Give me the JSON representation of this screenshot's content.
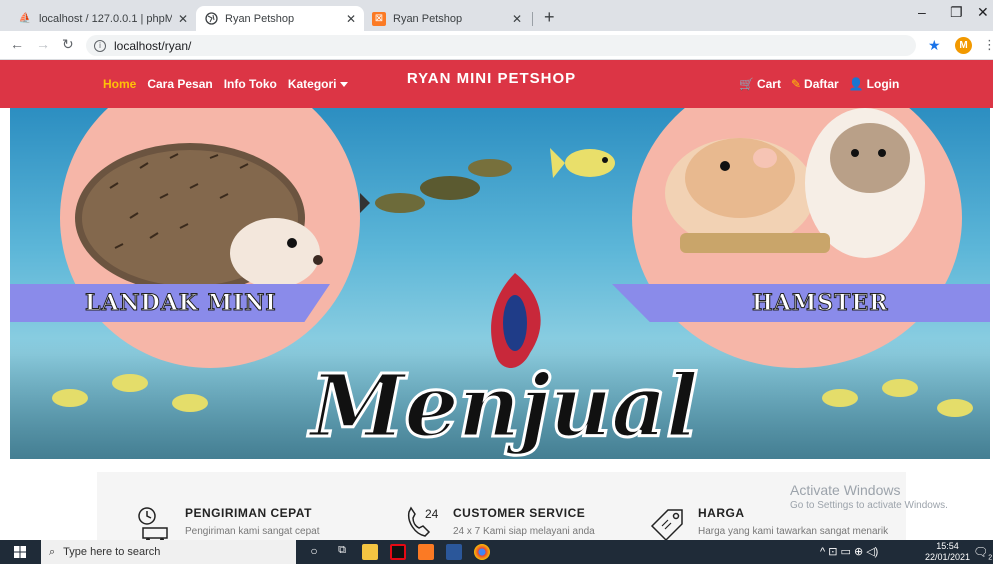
{
  "browser": {
    "tabs": [
      {
        "title": "localhost / 127.0.0.1 | phpMyAdm",
        "active": false
      },
      {
        "title": "Ryan Petshop",
        "active": true
      },
      {
        "title": "Ryan Petshop",
        "active": false
      }
    ],
    "url": "localhost/ryan/",
    "profile_initial": "M"
  },
  "navbar": {
    "links": [
      "Home",
      "Cara Pesan",
      "Info Toko",
      "Kategori"
    ],
    "brand": "RYAN MINI PETSHOP",
    "right": [
      "Cart",
      "Daftar",
      "Login"
    ]
  },
  "hero": {
    "left_label": "LANDAK MINI",
    "right_label": "HAMSTER",
    "headline": "Menjual"
  },
  "features": [
    {
      "title": "PENGIRIMAN CEPAT",
      "desc": "Pengiriman kami sangat cepat",
      "icon": "delivery-icon"
    },
    {
      "title": "CUSTOMER SERVICE",
      "desc": "24 x 7 Kami siap melayani anda",
      "icon": "phone-24-icon"
    },
    {
      "title": "HARGA",
      "desc": "Harga yang kami tawarkan sangat menarik",
      "icon": "price-tag-icon"
    }
  ],
  "watermark": {
    "line1": "Activate Windows",
    "line2": "Go to Settings to activate Windows."
  },
  "taskbar": {
    "search_placeholder": "Type here to search",
    "time": "15:54",
    "date": "22/01/2021",
    "notif_count": "2"
  },
  "colors": {
    "navbar_bg": "#dc3545",
    "active_link": "#ffc107"
  }
}
